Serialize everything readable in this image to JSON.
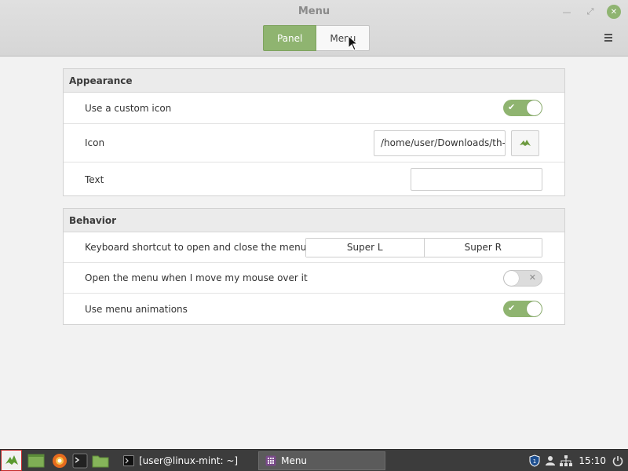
{
  "window": {
    "title": "Menu",
    "tabs": [
      {
        "label": "Panel",
        "active": true
      },
      {
        "label": "Menu",
        "active": false
      }
    ],
    "accent": "#8fb470"
  },
  "appearance": {
    "heading": "Appearance",
    "custom_icon": {
      "label": "Use a custom icon",
      "enabled": true
    },
    "icon": {
      "label": "Icon",
      "path": "/home/user/Downloads/th-"
    },
    "text": {
      "label": "Text",
      "value": ""
    }
  },
  "behavior": {
    "heading": "Behavior",
    "shortcut": {
      "label": "Keyboard shortcut to open and close the menu",
      "key1": "Super L",
      "key2": "Super R"
    },
    "hover_open": {
      "label": "Open the menu when I move my mouse over it",
      "enabled": false
    },
    "animations": {
      "label": "Use menu animations",
      "enabled": true
    }
  },
  "taskbar": {
    "windows": [
      {
        "label": "[user@linux-mint: ~]",
        "icon": "terminal-icon"
      },
      {
        "label": "Menu",
        "icon": "menu-app-icon"
      }
    ],
    "clock": "15:10"
  }
}
